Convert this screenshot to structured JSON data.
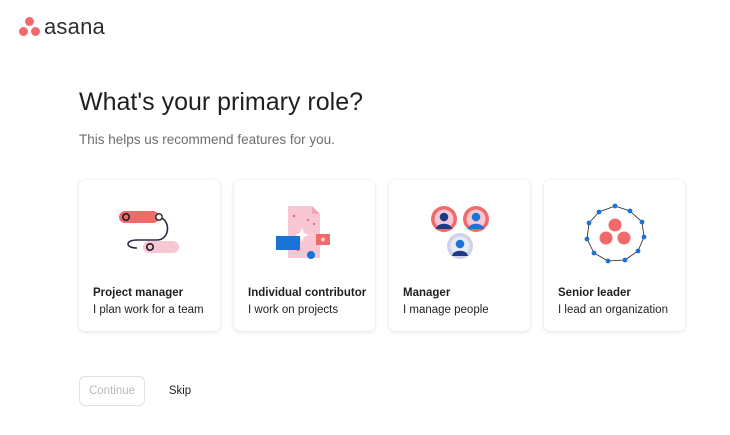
{
  "brand": {
    "name": "asana",
    "logo_icon": "asana-three-dots-icon",
    "logo_color": "#f06a6a"
  },
  "page": {
    "title": "What's your primary role?",
    "subtitle": "This helps us recommend features for you."
  },
  "roles": [
    {
      "title": "Project manager",
      "description": "I plan work for a team",
      "icon": "workflow-illustration-icon"
    },
    {
      "title": "Individual contributor",
      "description": "I work on projects",
      "icon": "document-illustration-icon"
    },
    {
      "title": "Manager",
      "description": "I manage people",
      "icon": "people-illustration-icon"
    },
    {
      "title": "Senior leader",
      "description": "I lead an organization",
      "icon": "organization-illustration-icon"
    }
  ],
  "actions": {
    "continue_label": "Continue",
    "skip_label": "Skip"
  },
  "colors": {
    "coral": "#f06a6a",
    "pink": "#f9c6d4",
    "blue": "#1a73d6",
    "text": "#1e1f21",
    "muted": "#6d6e6f",
    "disabled": "#b7b8b9"
  }
}
